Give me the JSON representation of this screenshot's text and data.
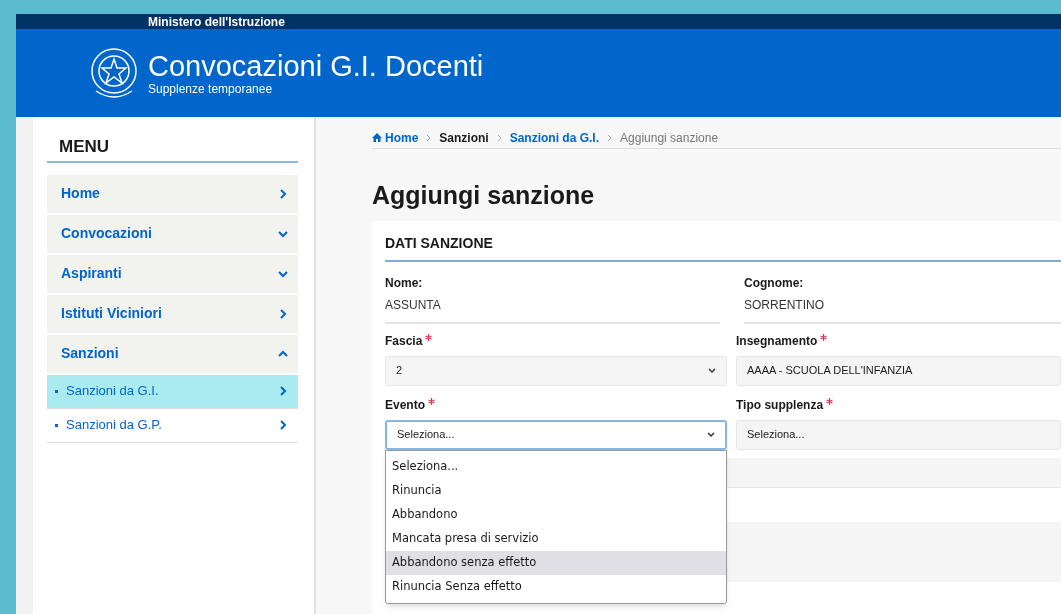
{
  "header": {
    "ministry": "Ministero dell'Istruzione",
    "title": "Convocazioni G.I. Docenti",
    "subtitle": "Supplenze temporanee"
  },
  "sidebar": {
    "heading": "MENU",
    "items": [
      {
        "label": "Home",
        "kind": "link"
      },
      {
        "label": "Convocazioni",
        "kind": "group",
        "expanded": false
      },
      {
        "label": "Aspiranti",
        "kind": "group",
        "expanded": false
      },
      {
        "label": "Istituti Viciniori",
        "kind": "link"
      },
      {
        "label": "Sanzioni",
        "kind": "group",
        "expanded": true,
        "children": [
          {
            "label": "Sanzioni da G.I.",
            "selected": true
          },
          {
            "label": "Sanzioni da G.P.",
            "selected": false
          }
        ]
      }
    ]
  },
  "breadcrumb": [
    {
      "label": "Home",
      "kind": "home"
    },
    {
      "label": "Sanzioni",
      "kind": "plain"
    },
    {
      "label": "Sanzioni da G.I.",
      "kind": "link"
    },
    {
      "label": "Aggiungi sanzione",
      "kind": "current"
    }
  ],
  "page_title": "Aggiungi sanzione",
  "form": {
    "section": "DATI SANZIONE",
    "readonly_fields": [
      {
        "label": "Nome:",
        "value": "ASSUNTA"
      },
      {
        "label": "Cognome:",
        "value": "SORRENTINO"
      }
    ],
    "selects": [
      {
        "label": "Fascia",
        "required": true,
        "value": "2",
        "focused": false,
        "arrow": true
      },
      {
        "label": "Insegnamento",
        "required": true,
        "value": "AAAA - SCUOLA DELL'INFANZIA",
        "focused": false,
        "arrow": false
      },
      {
        "label": "Evento",
        "required": true,
        "value": "Seleziona...",
        "focused": true,
        "arrow": true,
        "options": [
          {
            "label": "Seleziona...",
            "highlighted": false
          },
          {
            "label": "Rinuncia",
            "highlighted": false
          },
          {
            "label": "Abbandono",
            "highlighted": false
          },
          {
            "label": "Mancata presa di servizio",
            "highlighted": false
          },
          {
            "label": "Abbandono senza effetto",
            "highlighted": true
          },
          {
            "label": "Rinuncia Senza effetto",
            "highlighted": false
          }
        ]
      },
      {
        "label": "Tipo supplenza",
        "required": true,
        "value": "Seleziona...",
        "focused": false,
        "arrow": false
      }
    ]
  }
}
